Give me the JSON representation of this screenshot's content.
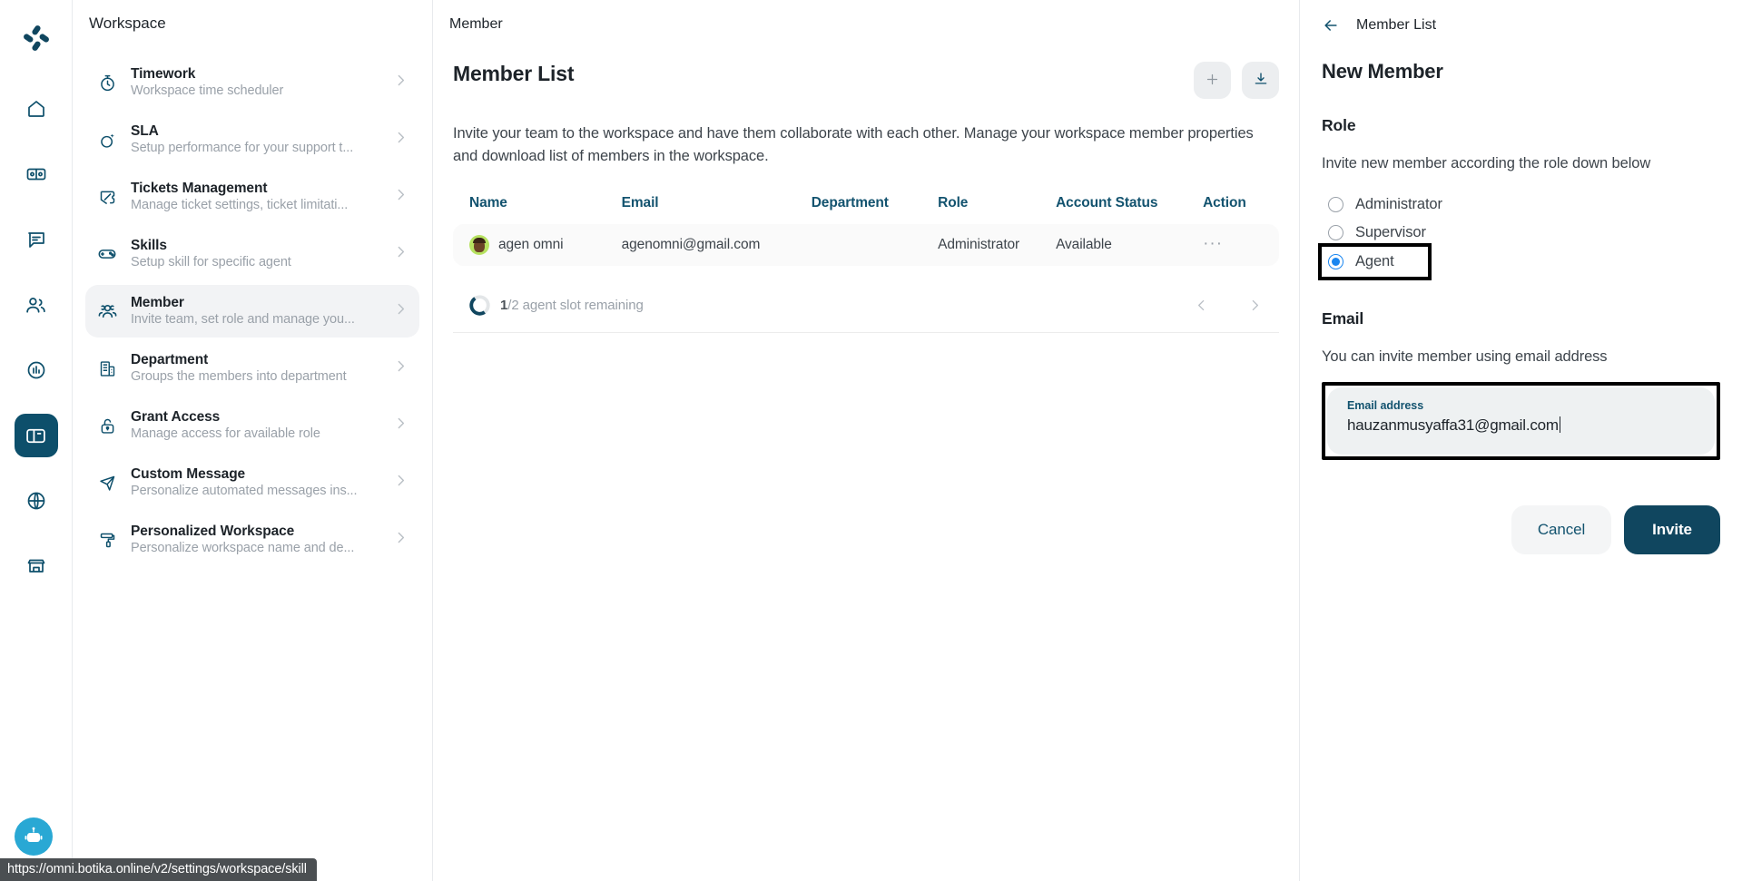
{
  "rail": {
    "logo_icon": "botika-logo-icon",
    "items": [
      {
        "icon": "home-icon",
        "name": "home",
        "active": false
      },
      {
        "icon": "ticket-icon",
        "name": "tickets",
        "active": false
      },
      {
        "icon": "chat-icon",
        "name": "chat",
        "active": false
      },
      {
        "icon": "contacts-icon",
        "name": "contacts",
        "active": false
      },
      {
        "icon": "analytics-icon",
        "name": "analytics",
        "active": false
      },
      {
        "icon": "workspace-icon",
        "name": "workspace",
        "active": true
      },
      {
        "icon": "globe-icon",
        "name": "channels",
        "active": false
      },
      {
        "icon": "store-icon",
        "name": "marketplace",
        "active": false
      }
    ],
    "bot_icon": "robot-assistant-icon"
  },
  "workspace": {
    "title": "Workspace",
    "items": [
      {
        "icon": "stopwatch-icon",
        "name": "Timework",
        "desc": "Workspace time scheduler",
        "active": false
      },
      {
        "icon": "sla-icon",
        "name": "SLA",
        "desc": "Setup performance for your support t...",
        "active": false
      },
      {
        "icon": "ticket-tag-icon",
        "name": "Tickets Management",
        "desc": "Manage ticket settings, ticket limitati...",
        "active": false
      },
      {
        "icon": "gamepad-icon",
        "name": "Skills",
        "desc": "Setup skill for specific agent",
        "active": false
      },
      {
        "icon": "people-icon",
        "name": "Member",
        "desc": "Invite team, set role and manage you...",
        "active": true
      },
      {
        "icon": "building-icon",
        "name": "Department",
        "desc": "Groups the members into department",
        "active": false
      },
      {
        "icon": "unlock-icon",
        "name": "Grant Access",
        "desc": "Manage access for available role",
        "active": false
      },
      {
        "icon": "send-icon",
        "name": "Custom Message",
        "desc": "Personalize automated messages ins...",
        "active": false
      },
      {
        "icon": "paint-roller-icon",
        "name": "Personalized Workspace",
        "desc": "Personalize workspace name and de...",
        "active": false
      }
    ]
  },
  "main": {
    "breadcrumb": "Member",
    "title": "Member List",
    "description": "Invite your team to the workspace and have them collaborate with each other. Manage your workspace member properties and download list of members in the workspace.",
    "add_button_icon": "plus-icon",
    "download_button_icon": "download-icon",
    "table": {
      "headers": [
        "Name",
        "Email",
        "Department",
        "Role",
        "Account Status",
        "Action"
      ],
      "rows": [
        {
          "name": "agen omni",
          "email": "agenomni@gmail.com",
          "department": "",
          "role": "Administrator",
          "status": "Available",
          "action": "···"
        }
      ]
    },
    "slot": {
      "count": "1",
      "total": "/2 agent slot remaining",
      "progress_percent": 50
    },
    "pager": {
      "prev_icon": "chevron-left-icon",
      "next_icon": "chevron-right-icon"
    }
  },
  "drawer": {
    "back_icon": "arrow-left-icon",
    "breadcrumb": "Member List",
    "title": "New Member",
    "role_section": "Role",
    "role_hint": "Invite new member according the role down below",
    "roles": [
      {
        "label": "Administrator",
        "selected": false,
        "highlighted": false
      },
      {
        "label": "Supervisor",
        "selected": false,
        "highlighted": false
      },
      {
        "label": "Agent",
        "selected": true,
        "highlighted": true
      }
    ],
    "email_section": "Email",
    "email_hint": "You can invite member using email address",
    "email_label": "Email address",
    "email_value": "hauzanmusyaffa31@gmail.com",
    "cancel_label": "Cancel",
    "invite_label": "Invite"
  },
  "status_bar": {
    "url": "https://omni.botika.online/v2/settings/workspace/skill"
  },
  "colors": {
    "brand_dark": "#10465f",
    "brand_teal": "#13536f",
    "radio_blue": "#1a86f0",
    "muted": "#9aa1a9",
    "bot_blue": "#29a8d4"
  }
}
